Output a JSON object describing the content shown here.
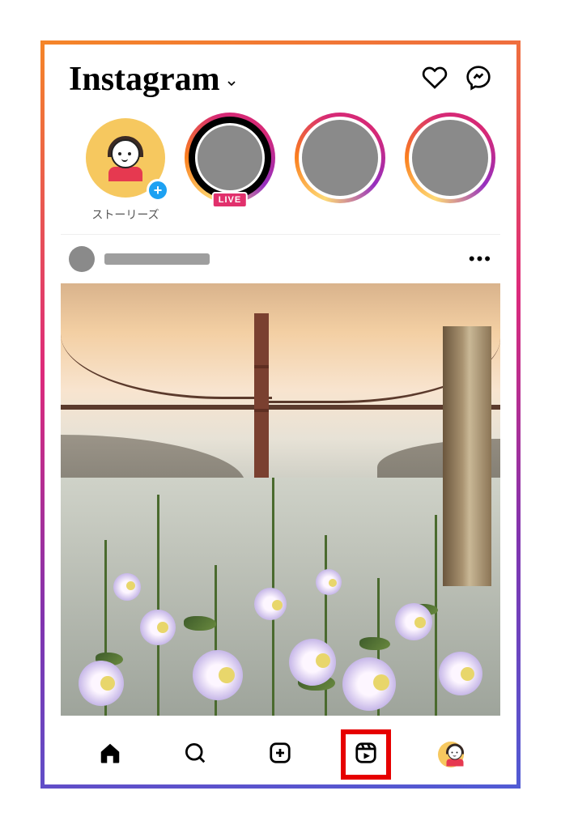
{
  "header": {
    "logo_text": "Instagram"
  },
  "stories": {
    "your_story_label": "ストーリーズ",
    "live_badge": "LIVE"
  },
  "post": {
    "more_glyph": "•••"
  },
  "nav": {
    "highlighted": "reels"
  }
}
